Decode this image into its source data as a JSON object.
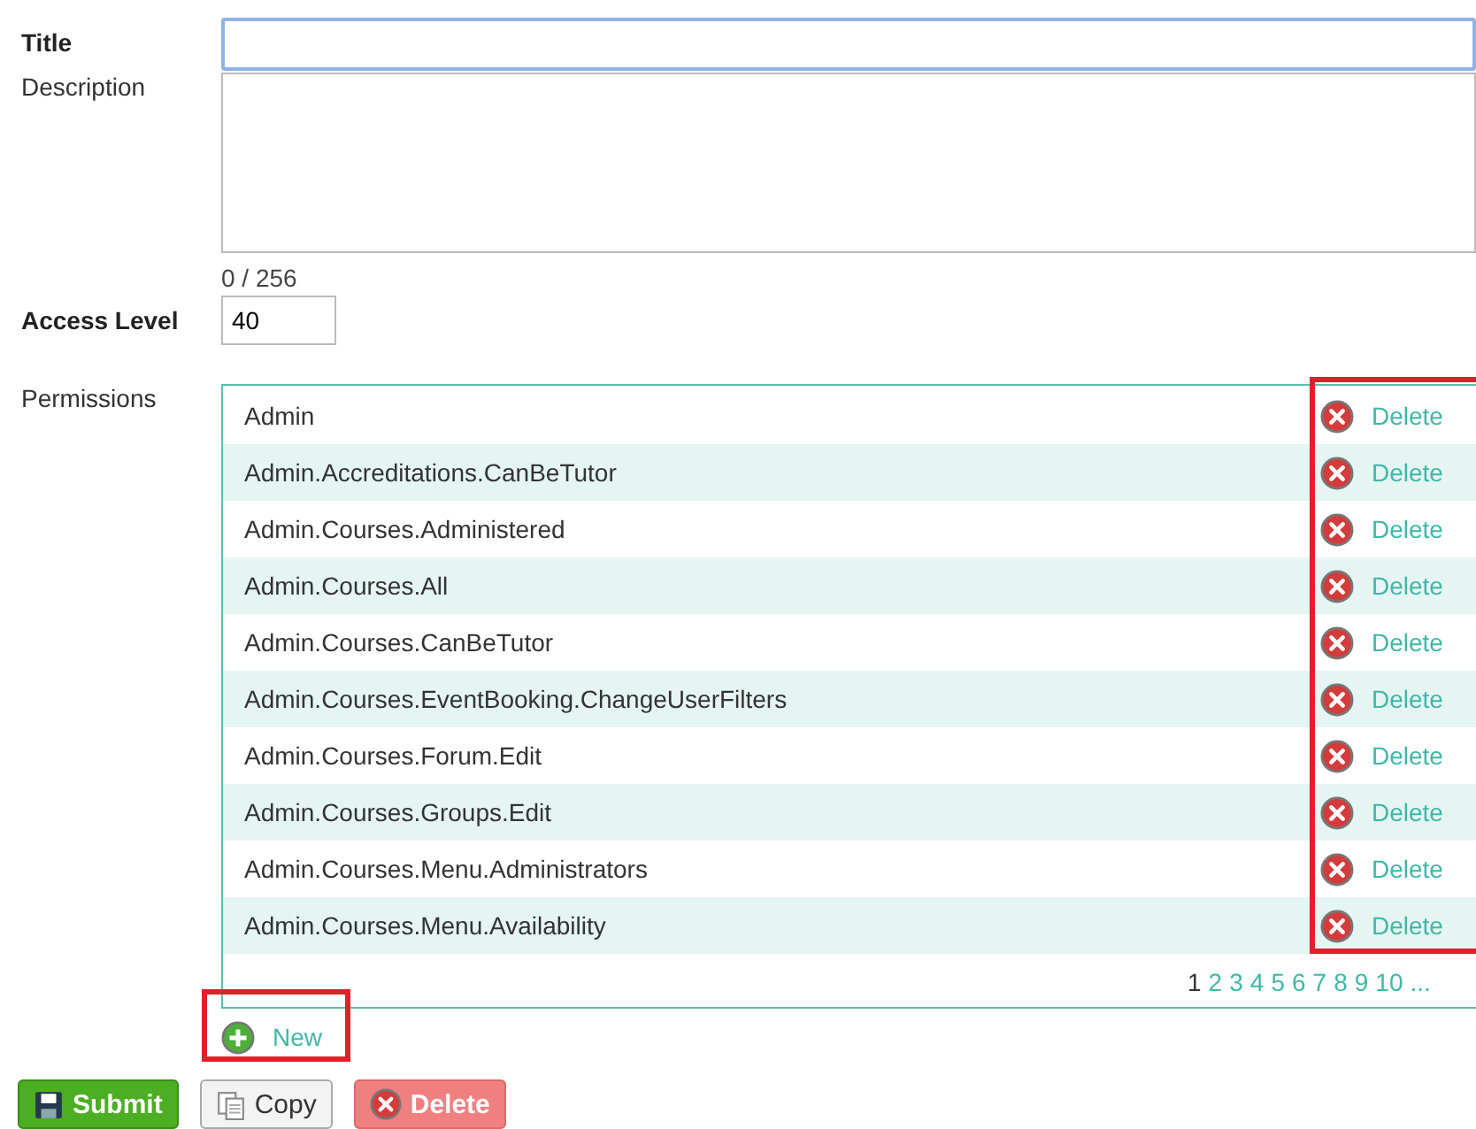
{
  "form": {
    "title": {
      "label": "Title"
    },
    "description": {
      "label": "Description",
      "counter": "0 / 256"
    },
    "access_level": {
      "label": "Access Level",
      "value": "40"
    },
    "permissions": {
      "label": "Permissions",
      "rows": [
        {
          "name": "Admin",
          "action": "Delete"
        },
        {
          "name": "Admin.Accreditations.CanBeTutor",
          "action": "Delete"
        },
        {
          "name": "Admin.Courses.Administered",
          "action": "Delete"
        },
        {
          "name": "Admin.Courses.All",
          "action": "Delete"
        },
        {
          "name": "Admin.Courses.CanBeTutor",
          "action": "Delete"
        },
        {
          "name": "Admin.Courses.EventBooking.ChangeUserFilters",
          "action": "Delete"
        },
        {
          "name": "Admin.Courses.Forum.Edit",
          "action": "Delete"
        },
        {
          "name": "Admin.Courses.Groups.Edit",
          "action": "Delete"
        },
        {
          "name": "Admin.Courses.Menu.Administrators",
          "action": "Delete"
        },
        {
          "name": "Admin.Courses.Menu.Availability",
          "action": "Delete"
        }
      ],
      "pages": [
        {
          "label": "1",
          "selected": true
        },
        {
          "label": "2",
          "selected": false
        },
        {
          "label": "3",
          "selected": false
        },
        {
          "label": "4",
          "selected": false
        },
        {
          "label": "5",
          "selected": false
        },
        {
          "label": "6",
          "selected": false
        },
        {
          "label": "7",
          "selected": false
        },
        {
          "label": "8",
          "selected": false
        },
        {
          "label": "9",
          "selected": false
        },
        {
          "label": "10",
          "selected": false
        },
        {
          "label": "...",
          "selected": false
        }
      ],
      "new_label": "New"
    },
    "buttons": [
      {
        "kind": "submit",
        "label": "Submit"
      },
      {
        "kind": "copy",
        "label": "Copy"
      },
      {
        "kind": "delete",
        "label": "Delete"
      }
    ]
  }
}
